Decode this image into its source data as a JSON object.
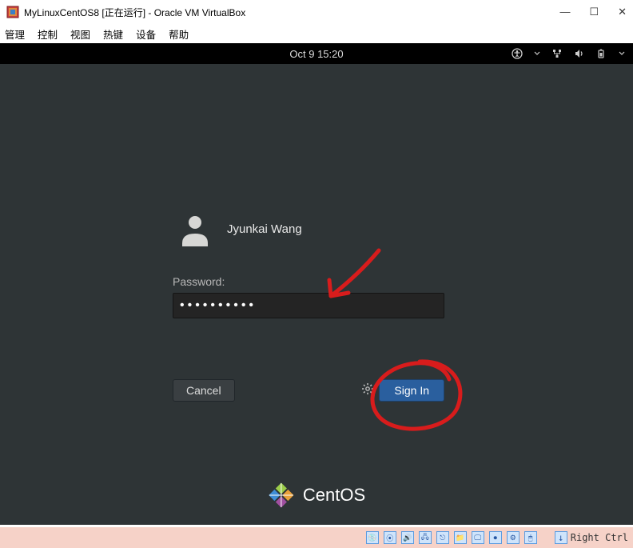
{
  "window": {
    "title": "MyLinuxCentOS8 [正在运行] - Oracle VM VirtualBox",
    "minimize": "—",
    "maximize": "☐",
    "close": "✕"
  },
  "menu": {
    "items": [
      "管理",
      "控制",
      "视图",
      "热键",
      "设备",
      "帮助"
    ]
  },
  "topbar": {
    "datetime": "Oct 9  15:20"
  },
  "login": {
    "username": "Jyunkai Wang",
    "password_label": "Password:",
    "password_value": "••••••••••",
    "cancel": "Cancel",
    "signin": "Sign In"
  },
  "centos": {
    "text": "CentOS"
  },
  "statusbar": {
    "host_key": "Right Ctrl"
  }
}
